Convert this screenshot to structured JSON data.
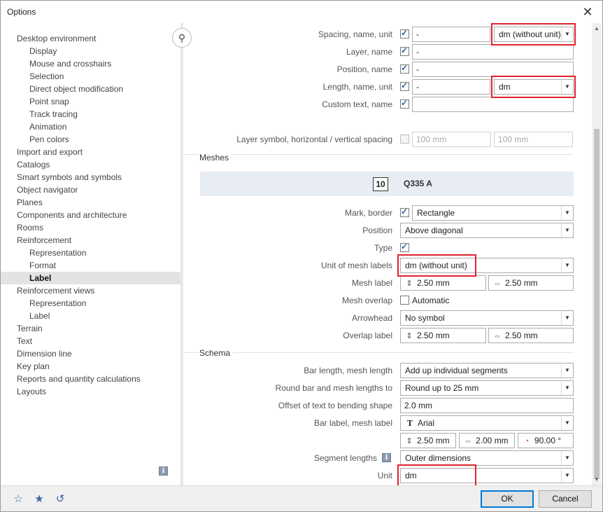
{
  "window": {
    "title": "Options",
    "close_glyph": "✕"
  },
  "nav": {
    "items": [
      {
        "label": "Desktop environment",
        "level": 0
      },
      {
        "label": "Display",
        "level": 1
      },
      {
        "label": "Mouse and crosshairs",
        "level": 1
      },
      {
        "label": "Selection",
        "level": 1
      },
      {
        "label": "Direct object modification",
        "level": 1
      },
      {
        "label": "Point snap",
        "level": 1
      },
      {
        "label": "Track tracing",
        "level": 1
      },
      {
        "label": "Animation",
        "level": 1
      },
      {
        "label": "Pen colors",
        "level": 1
      },
      {
        "label": "Import and export",
        "level": 0
      },
      {
        "label": "Catalogs",
        "level": 0
      },
      {
        "label": "Smart symbols and symbols",
        "level": 0
      },
      {
        "label": "Object navigator",
        "level": 0
      },
      {
        "label": "Planes",
        "level": 0
      },
      {
        "label": "Components and architecture",
        "level": 0
      },
      {
        "label": "Rooms",
        "level": 0
      },
      {
        "label": "Reinforcement",
        "level": 0
      },
      {
        "label": "Representation",
        "level": 1
      },
      {
        "label": "Format",
        "level": 1
      },
      {
        "label": "Label",
        "level": 1,
        "selected": true
      },
      {
        "label": "Reinforcement views",
        "level": 0
      },
      {
        "label": "Representation",
        "level": 1
      },
      {
        "label": "Label",
        "level": 1
      },
      {
        "label": "Terrain",
        "level": 0
      },
      {
        "label": "Text",
        "level": 0
      },
      {
        "label": "Dimension line",
        "level": 0
      },
      {
        "label": "Key plan",
        "level": 0
      },
      {
        "label": "Reports and quantity calculations",
        "level": 0
      },
      {
        "label": "Layouts",
        "level": 0
      }
    ],
    "info_glyph": "i",
    "search_glyph": "⚲"
  },
  "top": {
    "spacing": {
      "label": "Spacing, name, unit",
      "value": "-",
      "unit": "dm (without unit)"
    },
    "layer": {
      "label": "Layer, name",
      "value": "-"
    },
    "position": {
      "label": "Position, name",
      "value": "-"
    },
    "length": {
      "label": "Length, name, unit",
      "value": "-",
      "unit": "dm"
    },
    "custom_text": {
      "label": "Custom text, name",
      "value": ""
    },
    "layer_symbol": {
      "label": "Layer symbol, horizontal / vertical spacing",
      "h": "100 mm",
      "v": "100 mm"
    }
  },
  "meshes": {
    "header": "Meshes",
    "preview_number": "10",
    "preview_code": "Q335 A",
    "mark_border": {
      "label": "Mark, border",
      "value": "Rectangle"
    },
    "position": {
      "label": "Position",
      "value": "Above diagonal"
    },
    "type": {
      "label": "Type"
    },
    "unit_labels": {
      "label": "Unit of mesh labels",
      "value": "dm (without unit)"
    },
    "mesh_label": {
      "label": "Mesh label",
      "a": "2.50 mm",
      "b": "2.50 mm"
    },
    "mesh_overlap": {
      "label": "Mesh overlap",
      "check_label": "Automatic"
    },
    "arrowhead": {
      "label": "Arrowhead",
      "value": "No symbol"
    },
    "overlap_label": {
      "label": "Overlap label",
      "a": "2.50 mm",
      "b": "2.50 mm"
    }
  },
  "schema": {
    "header": "Schema",
    "bar_length": {
      "label": "Bar length, mesh length",
      "value": "Add up individual segments"
    },
    "round": {
      "label": "Round bar and mesh lengths to",
      "value": "Round up to 25 mm"
    },
    "offset": {
      "label": "Offset of text to bending shape",
      "value": "2.0 mm"
    },
    "bar_label": {
      "label": "Bar label, mesh label",
      "font": "Arial",
      "height": "2.50 mm",
      "width": "2.00 mm",
      "angle": "90.00 °"
    },
    "segment_lengths": {
      "label": "Segment lengths",
      "value": "Outer dimensions"
    },
    "unit": {
      "label": "Unit",
      "value": "dm"
    }
  },
  "footer": {
    "ok": "OK",
    "cancel": "Cancel"
  },
  "colors": {
    "highlight": "#e0232e",
    "checkmark": "#2b5aa8"
  }
}
